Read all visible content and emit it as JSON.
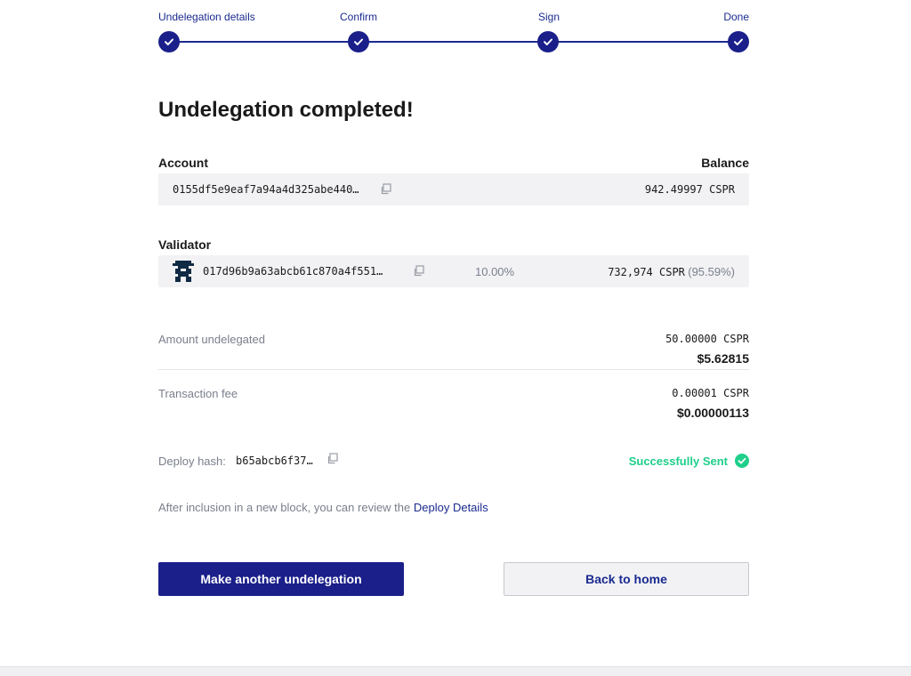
{
  "stepper": {
    "steps": [
      {
        "label": "Undelegation details"
      },
      {
        "label": "Confirm"
      },
      {
        "label": "Sign"
      },
      {
        "label": "Done"
      }
    ]
  },
  "title": "Undelegation completed!",
  "account": {
    "label": "Account",
    "balance_label": "Balance",
    "public_key": "0155df5e9eaf7a94a4d325abe440…",
    "balance": "942.49997 CSPR"
  },
  "validator": {
    "label": "Validator",
    "public_key": "017d96b9a63abcb61c870a4f551…",
    "fee": "10.00%",
    "stake": "732,974 CSPR",
    "stake_share": "(95.59%)"
  },
  "amount": {
    "label": "Amount undelegated",
    "cspr": "50.00000 CSPR",
    "usd": "$5.62815"
  },
  "fee": {
    "label": "Transaction fee",
    "cspr": "0.00001 CSPR",
    "usd": "$0.00000113"
  },
  "deploy": {
    "label": "Deploy hash:",
    "hash": "b65abcb6f37…",
    "status": "Successfully Sent"
  },
  "info": {
    "text": "After inclusion in a new block, you can review the ",
    "link": "Deploy Details"
  },
  "buttons": {
    "primary": "Make another undelegation",
    "secondary": "Back to home"
  },
  "colors": {
    "accent": "#1a1f8a",
    "success": "#1fcf8a",
    "panel": "#f2f2f4"
  }
}
